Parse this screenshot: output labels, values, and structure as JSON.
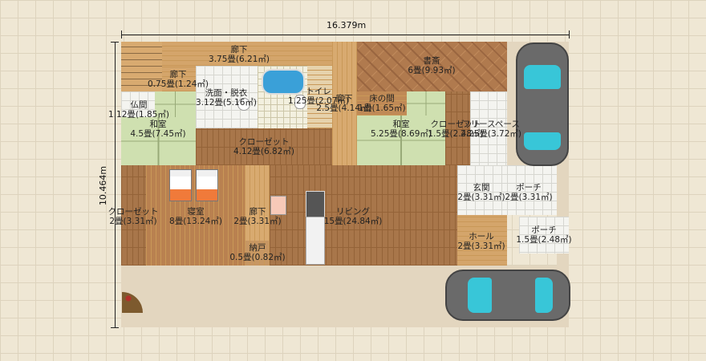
{
  "dimensions": {
    "width": "16.379m",
    "height": "10.464m"
  },
  "rooms": {
    "hall_top": {
      "name": "廊下",
      "area": "3.75畳(6.21㎡)"
    },
    "hall_stair": {
      "name": "廊下",
      "area": "0.75畳(1.24㎡)"
    },
    "butsuma": {
      "name": "仏間",
      "area": "1.12畳(1.85㎡)"
    },
    "washroom": {
      "name": "洗面・脱衣",
      "area": "3.12畳(5.16㎡)"
    },
    "toilet": {
      "name": "トイレ",
      "area": "1.25畳(2.07㎡)"
    },
    "hall_mid": {
      "name": "廊下",
      "area": "2.5畳(4.14㎡)"
    },
    "study": {
      "name": "書斎",
      "area": "6畳(9.93㎡)"
    },
    "tokonoma": {
      "name": "床の間",
      "area": "1畳(1.65㎡)"
    },
    "washitsu_left": {
      "name": "和室",
      "area": "4.5畳(7.45㎡)"
    },
    "closet_center": {
      "name": "クローゼット",
      "area": "4.12畳(6.82㎡)"
    },
    "washitsu_right": {
      "name": "和室",
      "area": "5.25畳(8.69㎡)"
    },
    "closet_right": {
      "name": "クローゼット",
      "area": "1.5畳(2.48㎡)"
    },
    "free_space": {
      "name": "フリースペース",
      "area": "2.25畳(3.72㎡)"
    },
    "closet_left": {
      "name": "クローゼット",
      "area": "2畳(3.31㎡)"
    },
    "bedroom": {
      "name": "寝室",
      "area": "8畳(13.24㎡)"
    },
    "hall_low": {
      "name": "廊下",
      "area": "2畳(3.31㎡)"
    },
    "nando": {
      "name": "納戸",
      "area": "0.5畳(0.82㎡)"
    },
    "living": {
      "name": "リビング",
      "area": "15畳(24.84㎡)"
    },
    "genkan": {
      "name": "玄関",
      "area": "2畳(3.31㎡)"
    },
    "porch_top": {
      "name": "ポーチ",
      "area": "2畳(3.31㎡)"
    },
    "hall_entry": {
      "name": "ホール",
      "area": "2畳(3.31㎡)"
    },
    "porch_bottom": {
      "name": "ポーチ",
      "area": "1.5畳(2.48㎡)"
    }
  }
}
